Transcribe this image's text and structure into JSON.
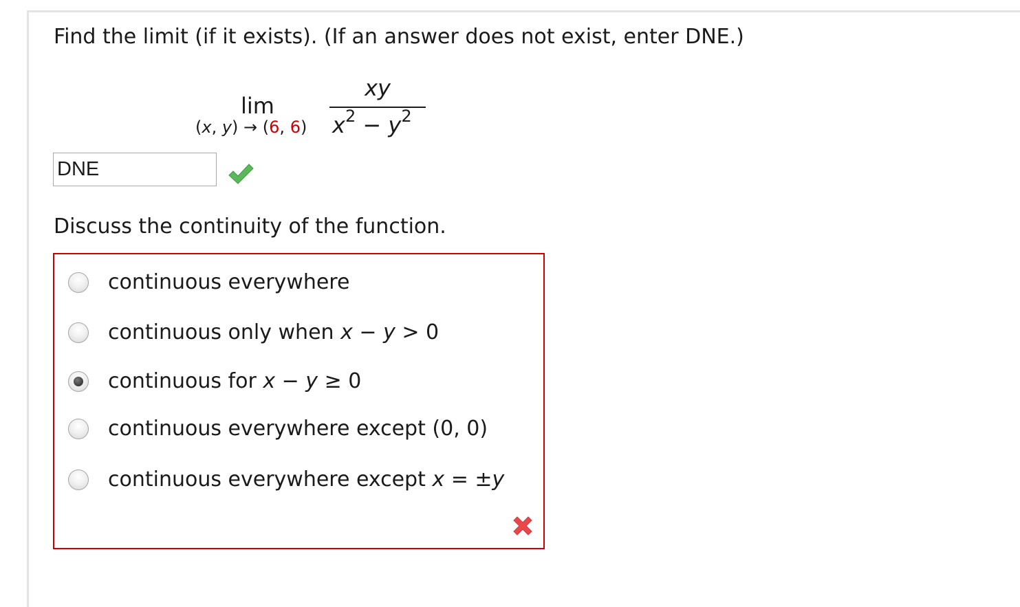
{
  "question1": {
    "prompt": "Find the limit (if it exists). (If an answer does not exist, enter DNE.)",
    "limit": {
      "operator": "lim",
      "approach_open": "(",
      "var_x": "x",
      "comma1": ", ",
      "var_y": "y",
      "arrow": ") → (",
      "point_x": "6",
      "comma2": ", ",
      "point_y": "6",
      "close": ")",
      "numerator": "xy",
      "den_x": "x",
      "den_exp1": "2",
      "den_minus": " − ",
      "den_y": "y",
      "den_exp2": "2"
    },
    "answer_value": "DNE",
    "answer_status_icon": "check-icon",
    "status_color_correct": "#5cb85c"
  },
  "question2": {
    "prompt": "Discuss the continuity of the function.",
    "border_color": "#cc0000",
    "options": [
      {
        "parts": [
          "continuous everywhere"
        ],
        "selected": false
      },
      {
        "parts": [
          "continuous only when ",
          "x",
          " − ",
          "y",
          " > 0"
        ],
        "selected": false
      },
      {
        "parts": [
          "continuous for ",
          "x",
          " − ",
          "y",
          " ≥ 0"
        ],
        "selected": true
      },
      {
        "parts": [
          "continuous everywhere except (0, 0)"
        ],
        "selected": false
      },
      {
        "parts": [
          "continuous everywhere except ",
          "x",
          " = ±",
          "y"
        ],
        "selected": false
      }
    ],
    "answer_status_icon": "x-icon",
    "status_color_incorrect": "#e8474b"
  }
}
